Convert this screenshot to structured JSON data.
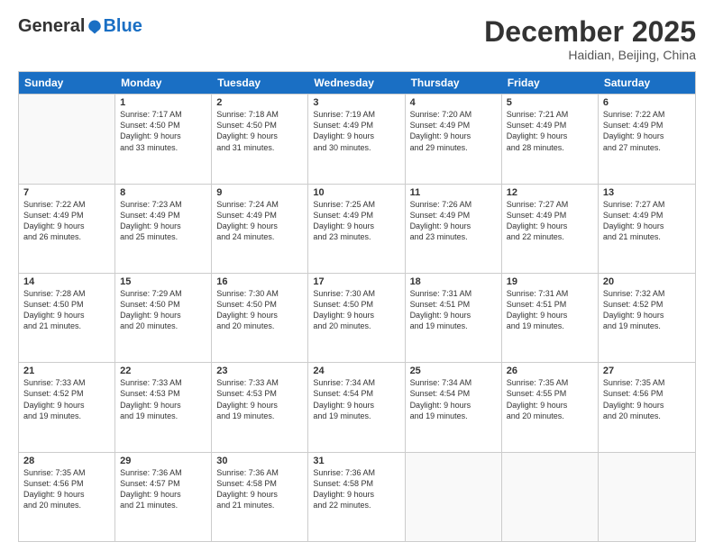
{
  "header": {
    "logo_general": "General",
    "logo_blue": "Blue",
    "month": "December 2025",
    "location": "Haidian, Beijing, China"
  },
  "weekdays": [
    "Sunday",
    "Monday",
    "Tuesday",
    "Wednesday",
    "Thursday",
    "Friday",
    "Saturday"
  ],
  "rows": [
    [
      {
        "num": "",
        "info": "",
        "empty": true
      },
      {
        "num": "1",
        "info": "Sunrise: 7:17 AM\nSunset: 4:50 PM\nDaylight: 9 hours\nand 33 minutes."
      },
      {
        "num": "2",
        "info": "Sunrise: 7:18 AM\nSunset: 4:50 PM\nDaylight: 9 hours\nand 31 minutes."
      },
      {
        "num": "3",
        "info": "Sunrise: 7:19 AM\nSunset: 4:49 PM\nDaylight: 9 hours\nand 30 minutes."
      },
      {
        "num": "4",
        "info": "Sunrise: 7:20 AM\nSunset: 4:49 PM\nDaylight: 9 hours\nand 29 minutes."
      },
      {
        "num": "5",
        "info": "Sunrise: 7:21 AM\nSunset: 4:49 PM\nDaylight: 9 hours\nand 28 minutes."
      },
      {
        "num": "6",
        "info": "Sunrise: 7:22 AM\nSunset: 4:49 PM\nDaylight: 9 hours\nand 27 minutes."
      }
    ],
    [
      {
        "num": "7",
        "info": "Sunrise: 7:22 AM\nSunset: 4:49 PM\nDaylight: 9 hours\nand 26 minutes."
      },
      {
        "num": "8",
        "info": "Sunrise: 7:23 AM\nSunset: 4:49 PM\nDaylight: 9 hours\nand 25 minutes."
      },
      {
        "num": "9",
        "info": "Sunrise: 7:24 AM\nSunset: 4:49 PM\nDaylight: 9 hours\nand 24 minutes."
      },
      {
        "num": "10",
        "info": "Sunrise: 7:25 AM\nSunset: 4:49 PM\nDaylight: 9 hours\nand 23 minutes."
      },
      {
        "num": "11",
        "info": "Sunrise: 7:26 AM\nSunset: 4:49 PM\nDaylight: 9 hours\nand 23 minutes."
      },
      {
        "num": "12",
        "info": "Sunrise: 7:27 AM\nSunset: 4:49 PM\nDaylight: 9 hours\nand 22 minutes."
      },
      {
        "num": "13",
        "info": "Sunrise: 7:27 AM\nSunset: 4:49 PM\nDaylight: 9 hours\nand 21 minutes."
      }
    ],
    [
      {
        "num": "14",
        "info": "Sunrise: 7:28 AM\nSunset: 4:50 PM\nDaylight: 9 hours\nand 21 minutes."
      },
      {
        "num": "15",
        "info": "Sunrise: 7:29 AM\nSunset: 4:50 PM\nDaylight: 9 hours\nand 20 minutes."
      },
      {
        "num": "16",
        "info": "Sunrise: 7:30 AM\nSunset: 4:50 PM\nDaylight: 9 hours\nand 20 minutes."
      },
      {
        "num": "17",
        "info": "Sunrise: 7:30 AM\nSunset: 4:50 PM\nDaylight: 9 hours\nand 20 minutes."
      },
      {
        "num": "18",
        "info": "Sunrise: 7:31 AM\nSunset: 4:51 PM\nDaylight: 9 hours\nand 19 minutes."
      },
      {
        "num": "19",
        "info": "Sunrise: 7:31 AM\nSunset: 4:51 PM\nDaylight: 9 hours\nand 19 minutes."
      },
      {
        "num": "20",
        "info": "Sunrise: 7:32 AM\nSunset: 4:52 PM\nDaylight: 9 hours\nand 19 minutes."
      }
    ],
    [
      {
        "num": "21",
        "info": "Sunrise: 7:33 AM\nSunset: 4:52 PM\nDaylight: 9 hours\nand 19 minutes."
      },
      {
        "num": "22",
        "info": "Sunrise: 7:33 AM\nSunset: 4:53 PM\nDaylight: 9 hours\nand 19 minutes."
      },
      {
        "num": "23",
        "info": "Sunrise: 7:33 AM\nSunset: 4:53 PM\nDaylight: 9 hours\nand 19 minutes."
      },
      {
        "num": "24",
        "info": "Sunrise: 7:34 AM\nSunset: 4:54 PM\nDaylight: 9 hours\nand 19 minutes."
      },
      {
        "num": "25",
        "info": "Sunrise: 7:34 AM\nSunset: 4:54 PM\nDaylight: 9 hours\nand 19 minutes."
      },
      {
        "num": "26",
        "info": "Sunrise: 7:35 AM\nSunset: 4:55 PM\nDaylight: 9 hours\nand 20 minutes."
      },
      {
        "num": "27",
        "info": "Sunrise: 7:35 AM\nSunset: 4:56 PM\nDaylight: 9 hours\nand 20 minutes."
      }
    ],
    [
      {
        "num": "28",
        "info": "Sunrise: 7:35 AM\nSunset: 4:56 PM\nDaylight: 9 hours\nand 20 minutes."
      },
      {
        "num": "29",
        "info": "Sunrise: 7:36 AM\nSunset: 4:57 PM\nDaylight: 9 hours\nand 21 minutes."
      },
      {
        "num": "30",
        "info": "Sunrise: 7:36 AM\nSunset: 4:58 PM\nDaylight: 9 hours\nand 21 minutes."
      },
      {
        "num": "31",
        "info": "Sunrise: 7:36 AM\nSunset: 4:58 PM\nDaylight: 9 hours\nand 22 minutes."
      },
      {
        "num": "",
        "info": "",
        "empty": true
      },
      {
        "num": "",
        "info": "",
        "empty": true
      },
      {
        "num": "",
        "info": "",
        "empty": true
      }
    ]
  ]
}
